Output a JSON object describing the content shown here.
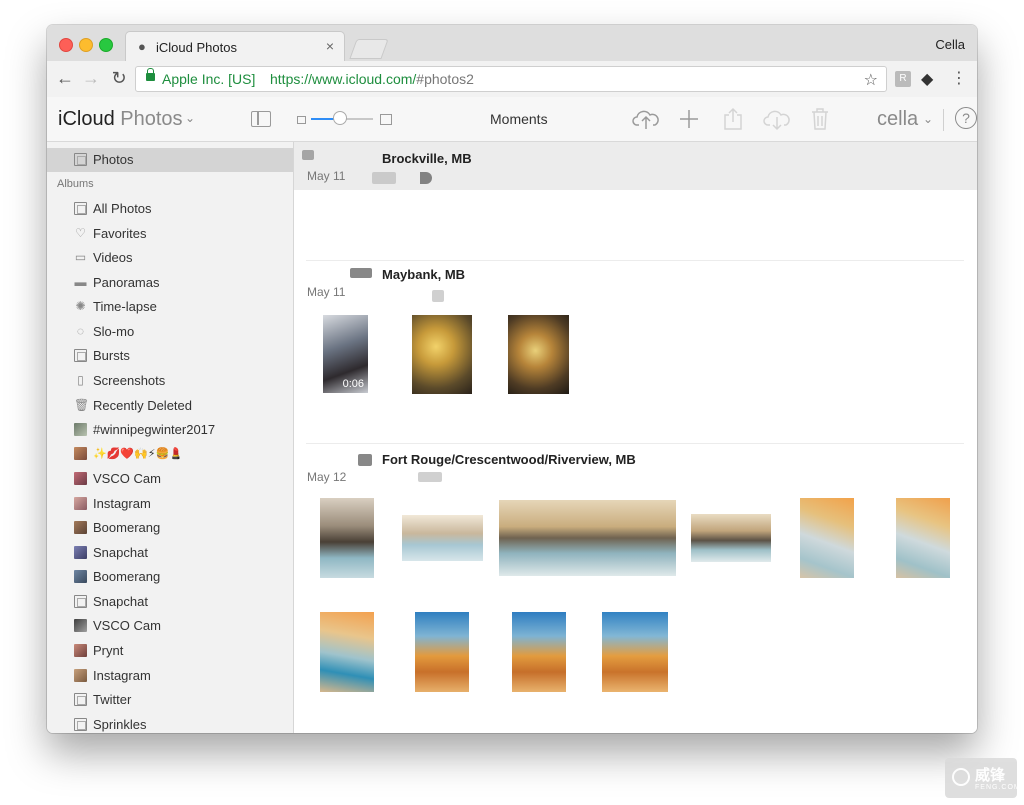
{
  "browser": {
    "tab_title": "iCloud Photos",
    "tab_close": "×",
    "profile_name": "Cella",
    "org_label": "Apple Inc. [US]",
    "url_host": "https://www.icloud.com/",
    "url_path": "#photos2",
    "back_glyph": "←",
    "forward_glyph": "→",
    "reload_glyph": "↻",
    "star_glyph": "☆",
    "menu_glyph": "⋮"
  },
  "app": {
    "title": "iCloud",
    "title_sub": " Photos",
    "view_label": "Moments",
    "user_name": "cella",
    "help_glyph": "?"
  },
  "sidebar": {
    "top_item": "Photos",
    "albums_header": "Albums",
    "items": [
      {
        "label": "All Photos",
        "icon": "album-icon"
      },
      {
        "label": "Favorites",
        "icon": "heart-icon"
      },
      {
        "label": "Videos",
        "icon": "video-icon"
      },
      {
        "label": "Panoramas",
        "icon": "panorama-icon"
      },
      {
        "label": "Time-lapse",
        "icon": "timelapse-icon"
      },
      {
        "label": "Slo-mo",
        "icon": "slomo-icon"
      },
      {
        "label": "Bursts",
        "icon": "bursts-icon"
      },
      {
        "label": "Screenshots",
        "icon": "phone-icon"
      },
      {
        "label": "Recently Deleted",
        "icon": "trash-icon"
      },
      {
        "label": "#winnipegwinter2017",
        "icon": "thumb-icon"
      },
      {
        "label": "✨💋❤️🙌⚡🍔💄",
        "icon": "thumb-icon"
      },
      {
        "label": "VSCO Cam",
        "icon": "thumb-icon"
      },
      {
        "label": "Instagram",
        "icon": "thumb-icon"
      },
      {
        "label": "Boomerang",
        "icon": "thumb-icon"
      },
      {
        "label": "Snapchat",
        "icon": "thumb-icon"
      },
      {
        "label": "Boomerang",
        "icon": "thumb-icon"
      },
      {
        "label": "Snapchat",
        "icon": "album-icon"
      },
      {
        "label": "VSCO Cam",
        "icon": "thumb-icon"
      },
      {
        "label": "Prynt",
        "icon": "thumb-icon"
      },
      {
        "label": "Instagram",
        "icon": "thumb-icon"
      },
      {
        "label": "Twitter",
        "icon": "album-icon"
      },
      {
        "label": "Sprinkles",
        "icon": "album-icon"
      }
    ]
  },
  "moments": [
    {
      "title": "Brockville, MB",
      "date": "May 11"
    },
    {
      "title": "Maybank, MB",
      "date": "May 11",
      "video_duration": "0:06"
    },
    {
      "title": "Fort Rouge/Crescentwood/Riverview, MB",
      "date": "May 12"
    }
  ],
  "watermark": {
    "text": "威锋",
    "sub": "FENG.COM"
  },
  "colors": {
    "accent": "#2f8df6",
    "secure_green": "#1e8e3e"
  }
}
